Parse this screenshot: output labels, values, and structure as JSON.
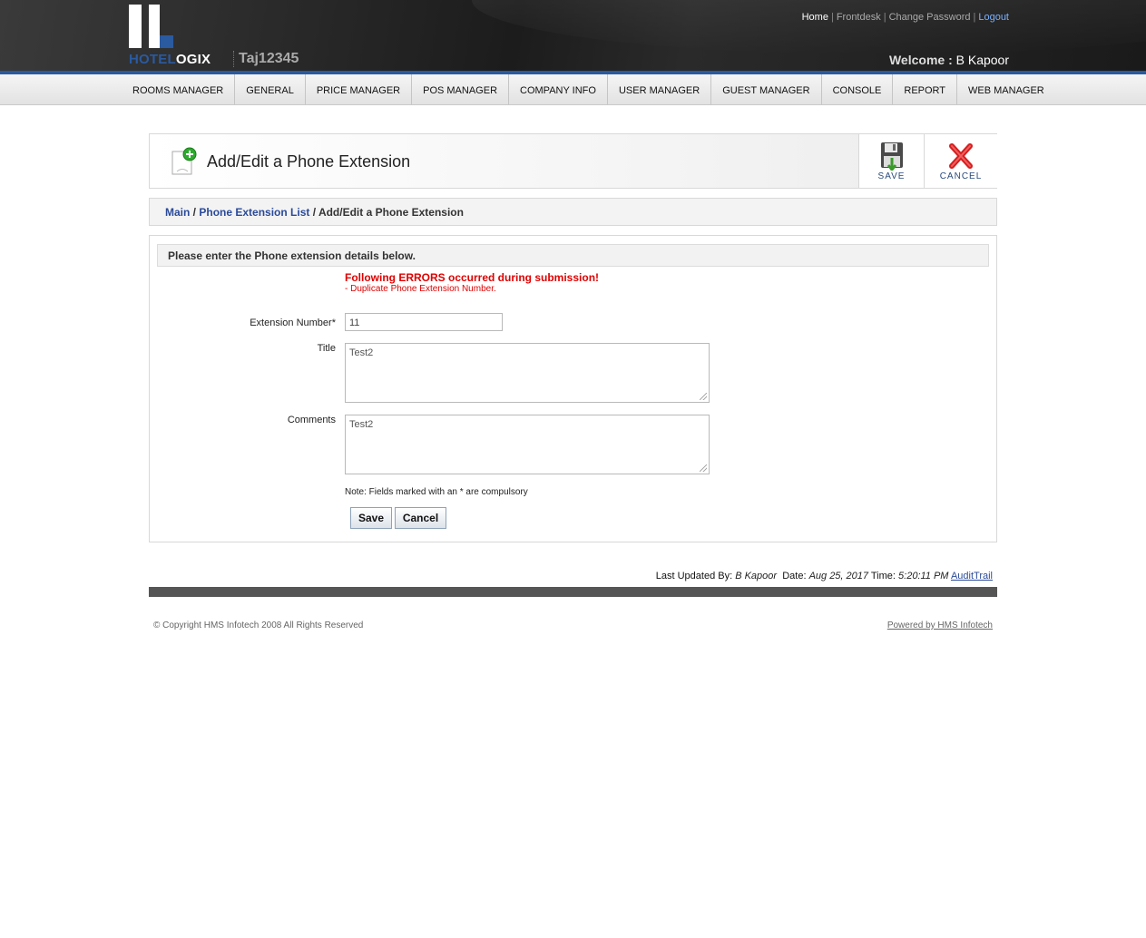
{
  "header": {
    "brand_left": "HOTEL",
    "brand_right": "OGIX",
    "property_code": "Taj12345",
    "links": {
      "home": "Home",
      "frontdesk": "Frontdesk",
      "change_password": "Change Password",
      "logout": "Logout"
    },
    "welcome_label": "Welcome :",
    "welcome_user": "B Kapoor"
  },
  "nav": [
    "ROOMS MANAGER",
    "GENERAL",
    "PRICE MANAGER",
    "POS MANAGER",
    "COMPANY INFO",
    "USER MANAGER",
    "GUEST MANAGER",
    "CONSOLE",
    "REPORT",
    "WEB MANAGER"
  ],
  "titlebar": {
    "title": "Add/Edit a Phone Extension",
    "save_label": "SAVE",
    "cancel_label": "CANCEL"
  },
  "breadcrumb": {
    "main": "Main",
    "sep": " / ",
    "list": "Phone Extension List",
    "current": "Add/Edit a Phone Extension"
  },
  "form": {
    "heading": "Please enter the Phone extension details below.",
    "error_title": "Following ERRORS occurred during submission!",
    "error_detail": "- Duplicate Phone Extension Number.",
    "extension_label": "Extension Number*",
    "extension_value": "11",
    "title_label": "Title",
    "title_value": "Test2",
    "comments_label": "Comments",
    "comments_value": "Test2",
    "note": "Note: Fields marked with an * are compulsory",
    "save_button": "Save",
    "cancel_button": "Cancel"
  },
  "footer": {
    "updated_by_label": "Last Updated By:",
    "updated_by": "B Kapoor",
    "date_label": "Date:",
    "date": "Aug 25, 2017",
    "time_label": "Time:",
    "time": "5:20:11 PM",
    "audit": "AuditTrail",
    "copyright": "© Copyright HMS Infotech 2008 All Rights Reserved",
    "powered": "Powered by HMS Infotech"
  },
  "colors": {
    "brand_blue": "#2a5aa0",
    "error": "#e00000",
    "link": "#2a4a9a"
  }
}
